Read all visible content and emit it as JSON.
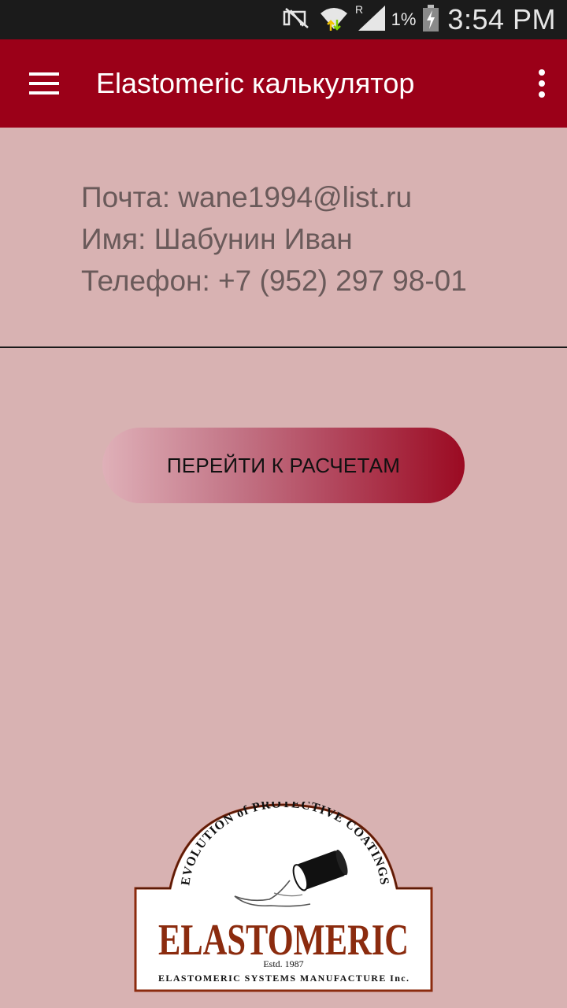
{
  "status_bar": {
    "time": "3:54 PM",
    "battery_percent": "1%",
    "icons": [
      "nfc-off-icon",
      "wifi-icon",
      "roaming-signal-icon",
      "battery-charging-icon"
    ],
    "roaming_letter": "R"
  },
  "app_bar": {
    "title": "Elastomeric калькулятор",
    "menu_icon": "hamburger-menu-icon",
    "overflow_icon": "more-vert-icon",
    "color": "#9b0018"
  },
  "user": {
    "email_line": "Почта: wane1994@list.ru",
    "name_line": "Имя: Шабунин Иван",
    "phone_line": "Телефон: +7 (952) 297 98-01"
  },
  "actions": {
    "go_to_calculations": "ПЕРЕЙТИ К РАСЧЕТАМ"
  },
  "logo": {
    "arc_text": "EVOLUTION of PROTECTIVE COATINGS",
    "brand": "ELASTOMERIC",
    "established": "Estd. 1987",
    "company": "ELASTOMERIC SYSTEMS MANUFACTURE Inc."
  },
  "colors": {
    "background": "#d8b2b2",
    "brand_red": "#9b0018",
    "logo_brown": "#8b2b0e"
  }
}
